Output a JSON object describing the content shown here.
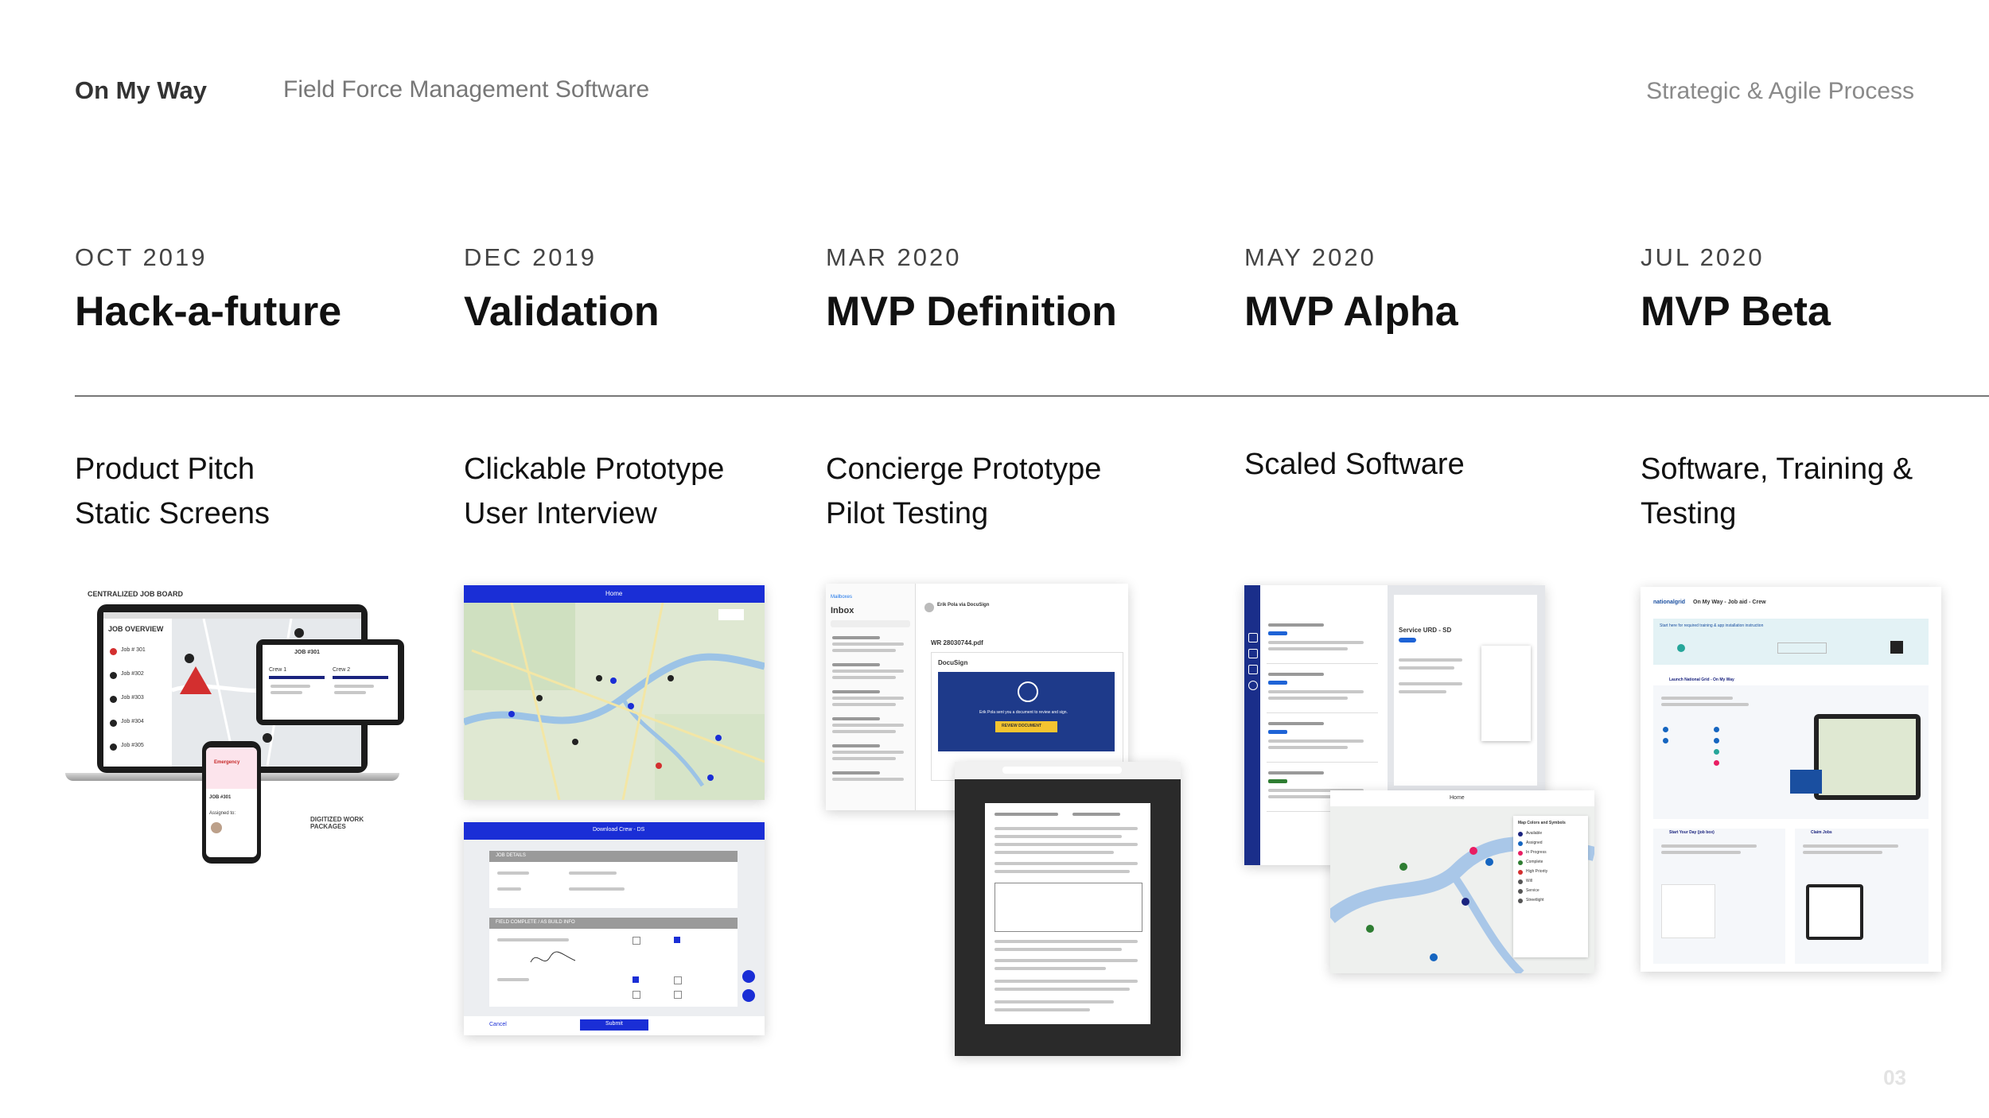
{
  "header": {
    "brand": "On My Way",
    "subtitle": "Field Force Management Software",
    "process": "Strategic & Agile Process"
  },
  "page_number": "03",
  "timeline": [
    {
      "date": "OCT 2019",
      "phase": "Hack-a-future",
      "lines": [
        "Product Pitch",
        "Static Screens"
      ]
    },
    {
      "date": "DEC 2019",
      "phase": "Validation",
      "lines": [
        "Clickable Prototype",
        "User Interview"
      ]
    },
    {
      "date": "MAR 2020",
      "phase": "MVP Definition",
      "lines": [
        "Concierge Prototype",
        "Pilot Testing"
      ]
    },
    {
      "date": "MAY 2020",
      "phase": "MVP Alpha",
      "lines": [
        "Scaled Software"
      ]
    },
    {
      "date": "JUL 2020",
      "phase": "MVP Beta",
      "lines": [
        "Software, Training &",
        "Testing"
      ]
    }
  ],
  "screens": {
    "hack": {
      "board_label": "CENTRALIZED JOB BOARD",
      "overview": "JOB OVERVIEW",
      "jobs": [
        "Job # 301",
        "Job #302",
        "Job #303",
        "Job #304",
        "Job #305"
      ],
      "tablet_job": "JOB #301",
      "crew1": "Crew 1",
      "crew2": "Crew 2",
      "emergency": "Emergency",
      "phone_job": "JOB #301",
      "assigned": "Assigned to:",
      "digitized": "DIGITIZED WORK PACKAGES"
    },
    "validation": {
      "map_title": "Home",
      "form_title": "Download Crew - DS",
      "job_details": "JOB DETAILS",
      "field_complete": "FIELD COMPLETE / AS BUILD INFO",
      "cancel": "Cancel",
      "submit": "Submit"
    },
    "mvp_def": {
      "mailbox": "Mailboxes",
      "inbox": "Inbox",
      "sender": "Erik Pola via DocuSign",
      "file": "WR 28030744.pdf",
      "docusign": "DocuSign",
      "review_text": "Erik Pola sent you a document to review and sign.",
      "review_btn": "REVIEW DOCUMENT"
    },
    "alpha": {
      "service": "Service URD - SD",
      "home": "Home",
      "legend_title": "Map Colors and Symbols",
      "legend": [
        "Available",
        "Assigned",
        "In Progress",
        "Complete",
        "High Priority",
        "Will",
        "Service",
        "Streetlight"
      ]
    },
    "beta": {
      "logo": "nationalgrid",
      "title": "On My Way - Job aid - Crew",
      "banner": "Start here for required training & app installation instruction",
      "launch": "Launch National Grid - On My Way",
      "start_day": "Start Your Day (job box)",
      "claim": "Claim Jobs"
    }
  }
}
